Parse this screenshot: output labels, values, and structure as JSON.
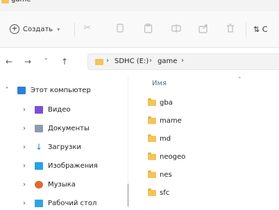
{
  "window": {
    "title": "game"
  },
  "toolbar": {
    "create_label": "Создать",
    "sort_label": "⇅ С"
  },
  "address": {
    "crumbs": [
      "SDHC (E:)",
      "game"
    ]
  },
  "sidebar": {
    "items": [
      {
        "label": "Этот компьютер",
        "icon": "computer-icon",
        "color": "#2f7fd8",
        "expanded": true
      },
      {
        "label": "Видео",
        "icon": "video-icon",
        "color": "#7a4fd6"
      },
      {
        "label": "Документы",
        "icon": "documents-icon",
        "color": "#8c9bb0"
      },
      {
        "label": "Загрузки",
        "icon": "downloads-icon",
        "color": "#1f86d9"
      },
      {
        "label": "Изображения",
        "icon": "images-icon",
        "color": "#2aa0e8"
      },
      {
        "label": "Музыка",
        "icon": "music-icon",
        "color": "#e0682f"
      },
      {
        "label": "Рабочий стол",
        "icon": "desktop-icon",
        "color": "#33a3e0"
      }
    ]
  },
  "files": {
    "column_name": "Имя",
    "items": [
      "gba",
      "mame",
      "md",
      "neogeo",
      "nes",
      "sfc"
    ]
  },
  "colors": {
    "folder": "#f2c45a",
    "accent": "#2f7fd8"
  }
}
